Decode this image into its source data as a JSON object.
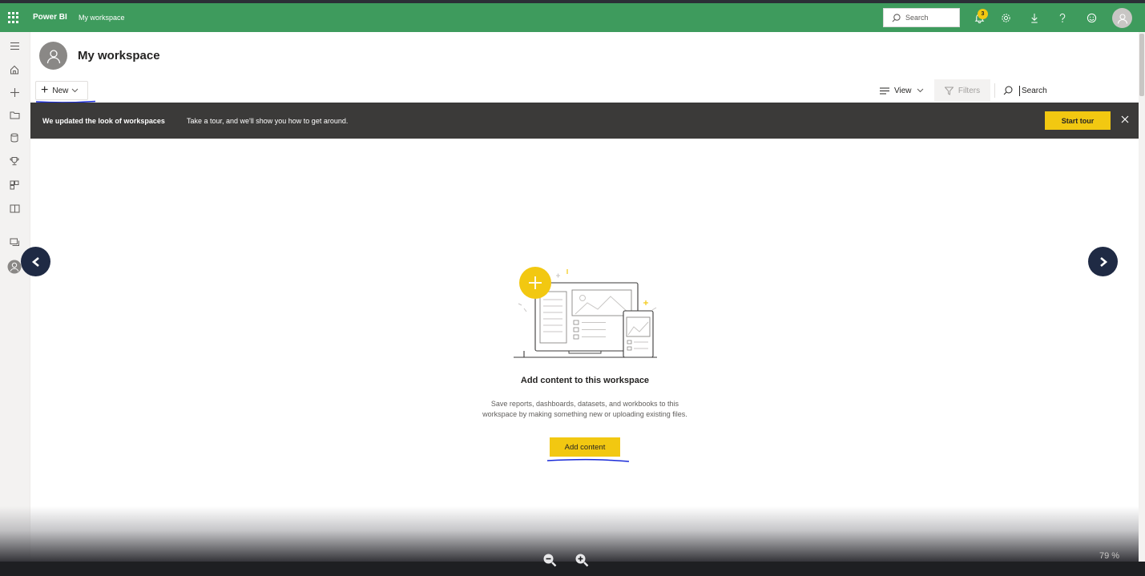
{
  "topbar": {
    "brand": "Power BI",
    "breadcrumb": "My workspace",
    "search_placeholder": "Search",
    "notification_count": "3",
    "color": "#3e9b5d"
  },
  "left_nav": {
    "items": [
      "menu-icon",
      "home-icon",
      "create-icon",
      "browse-icon",
      "datahub-icon",
      "goals-icon",
      "apps-icon",
      "learn-icon",
      "workspaces-icon",
      "my-workspace-icon"
    ]
  },
  "workspace": {
    "title": "My workspace"
  },
  "toolbar": {
    "new_label": "New",
    "view_label": "View",
    "filters_label": "Filters",
    "search_label": "Search"
  },
  "banner": {
    "bold_text": "We updated the look of workspaces",
    "text": "Take a tour, and we'll show you how to get around.",
    "tour_button": "Start tour"
  },
  "empty_state": {
    "title": "Add content to this workspace",
    "description_line1": "Save reports, dashboards, datasets, and workbooks to this",
    "description_line2": "workspace by making something new or uploading existing files.",
    "button_label": "Add content"
  },
  "viewer": {
    "zoom_level": "79 %"
  },
  "colors": {
    "accent_yellow": "#f2c811",
    "banner_bg": "#3b3a39",
    "nav_circle": "#1f2a44",
    "annotation_blue": "#1a2bd8"
  }
}
